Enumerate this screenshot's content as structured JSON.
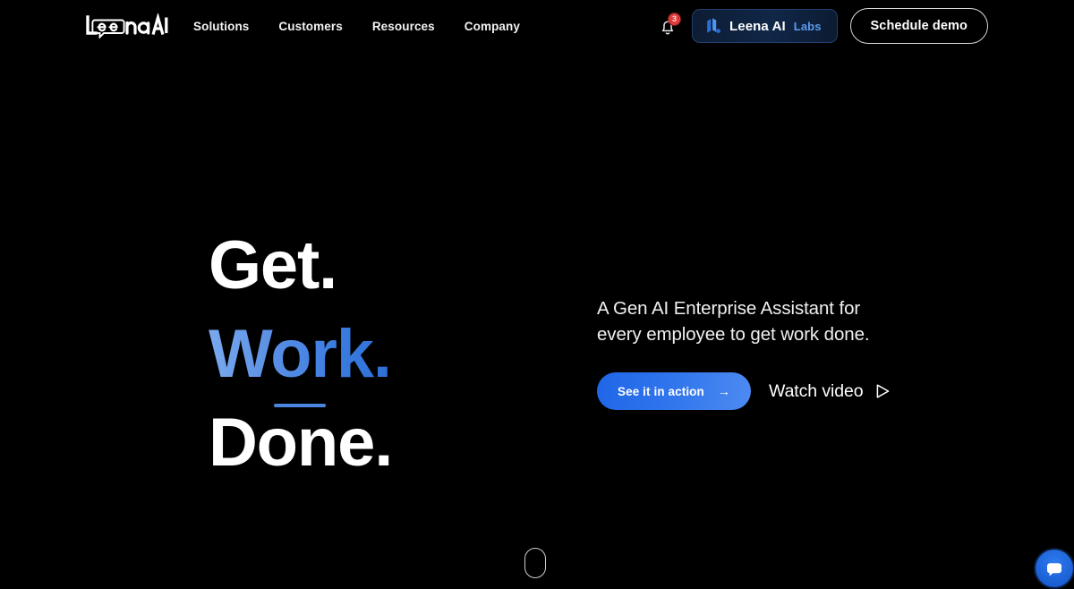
{
  "brand": {
    "logo_text": "Leena AI",
    "accent_blue": "#4a86e0",
    "cta_blue": "#2f74ec",
    "badge_red": "#e03b3b",
    "background": "#000000"
  },
  "header": {
    "logo_name": "leena-ai-logo",
    "nav": [
      {
        "label": "Solutions"
      },
      {
        "label": "Customers"
      },
      {
        "label": "Resources"
      },
      {
        "label": "Company"
      }
    ],
    "notifications": {
      "icon": "bell-icon",
      "count": "3"
    },
    "labs_button": {
      "icon": "leena-labs-icon",
      "label": "Leena AI",
      "sublabel": "Labs"
    },
    "demo_button": {
      "label": "Schedule demo"
    }
  },
  "hero": {
    "headline": {
      "line1": "Get.",
      "line2": "Work.",
      "line3": "Done."
    },
    "subheading": "A Gen AI Enterprise Assistant for every employee to get work done.",
    "primary_cta": {
      "label": "See it in action",
      "icon": "arrow-right-icon"
    },
    "secondary_cta": {
      "label": "Watch video",
      "icon": "play-triangle-icon"
    }
  },
  "footer_widgets": {
    "scroll_indicator": "scroll-down-mouse-icon",
    "chat": "chat-bubble-icon"
  }
}
